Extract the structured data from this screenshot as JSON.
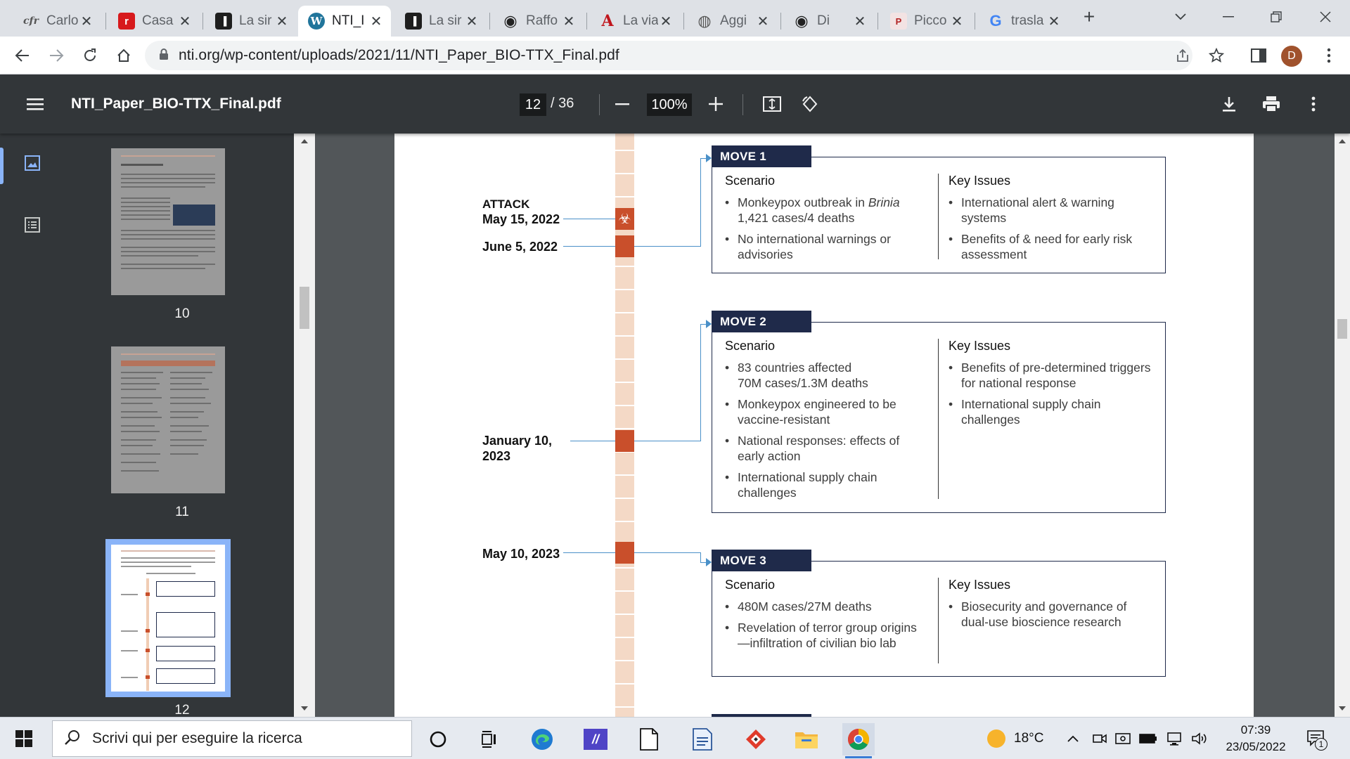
{
  "browser": {
    "tabs": [
      {
        "icon": "cfr-icon",
        "glyph": "cfr",
        "label": "Carlo"
      },
      {
        "icon": "casa-icon",
        "glyph": "r",
        "label": "Casa"
      },
      {
        "icon": "book-icon",
        "glyph": "▐",
        "label": "La sir"
      },
      {
        "icon": "wordpress-icon",
        "glyph": "W",
        "label": "NTI_I"
      },
      {
        "icon": "book-icon",
        "glyph": "▐",
        "label": "La sir"
      },
      {
        "icon": "globe-dark-icon",
        "glyph": "◉",
        "label": "Raffo"
      },
      {
        "icon": "a-logo-icon",
        "glyph": "A",
        "label": "La via"
      },
      {
        "icon": "globe-icon",
        "glyph": "◍",
        "label": "Aggi"
      },
      {
        "icon": "globe-dark-icon",
        "glyph": "◉",
        "label": "Di"
      },
      {
        "icon": "picco-icon",
        "glyph": "P",
        "label": "Picco"
      },
      {
        "icon": "google-icon",
        "glyph": "G",
        "label": "trasla"
      }
    ],
    "active_tab_index": 3,
    "url": "nti.org/wp-content/uploads/2021/11/NTI_Paper_BIO-TTX_Final.pdf",
    "profile_initial": "D"
  },
  "pdf": {
    "filename": "NTI_Paper_BIO-TTX_Final.pdf",
    "current_page": "12",
    "total_pages": "/ 36",
    "zoom": "100%",
    "thumbnails": [
      {
        "page": "10"
      },
      {
        "page": "11"
      },
      {
        "page": "12"
      }
    ]
  },
  "document": {
    "attack_label": "ATTACK",
    "dates": [
      "May 15, 2022",
      "June 5, 2022",
      "January 10,",
      "2023",
      "May 10, 2023"
    ],
    "scenario_heading": "Scenario",
    "key_issues_heading": "Key Issues",
    "moves": [
      {
        "tag": "MOVE 1",
        "scenario": [
          {
            "text": "Monkeypox outbreak in ",
            "em": "Brinia",
            "text2": "1,421 cases/4 deaths"
          },
          {
            "text": "No international warnings or advisories"
          }
        ],
        "key_issues": [
          "International alert & warning systems",
          "Benefits of & need for early risk assessment"
        ]
      },
      {
        "tag": "MOVE 2",
        "scenario": [
          {
            "text": "83 countries affected",
            "text2": "70M cases/1.3M deaths"
          },
          {
            "text": "Monkeypox engineered to be vaccine-resistant"
          },
          {
            "text": "National responses: effects of early action"
          },
          {
            "text": "International supply chain challenges"
          }
        ],
        "key_issues": [
          "Benefits of pre-determined triggers for national response",
          "International supply chain challenges"
        ]
      },
      {
        "tag": "MOVE 3",
        "scenario": [
          {
            "text": "480M cases/27M deaths"
          },
          {
            "text": "Revelation of terror group origins—infiltration of civilian bio lab"
          }
        ],
        "key_issues": [
          "Biosecurity and governance of dual-use bioscience research"
        ]
      }
    ]
  },
  "taskbar": {
    "search_placeholder": "Scrivi qui per eseguire la ricerca",
    "temperature": "18°C",
    "time": "07:39",
    "date": "23/05/2022",
    "notification_count": "1"
  }
}
